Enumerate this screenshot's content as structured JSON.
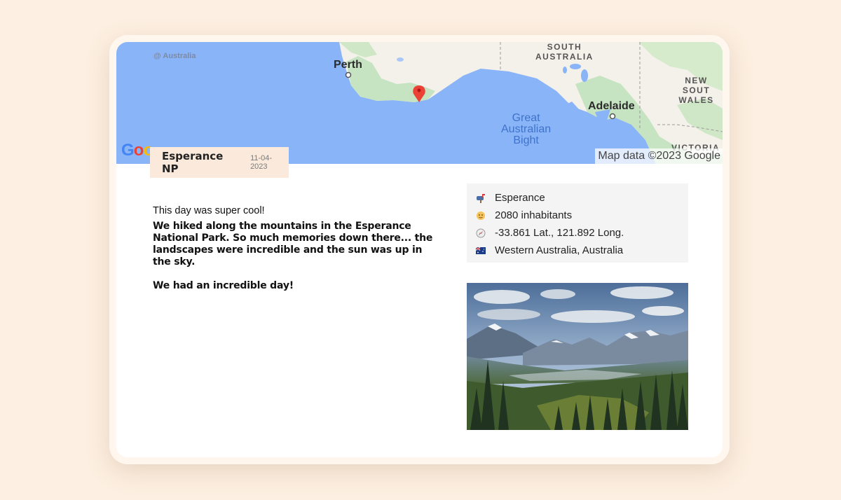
{
  "map": {
    "location_label": "@ Australia",
    "labels": {
      "south_australia": "SOUTH\nAUSTRALIA",
      "new_south_wales": "NEW SOUT\nWALES",
      "victoria": "VICTORIA",
      "perth": "Perth",
      "adelaide": "Adelaide",
      "bight": "Great\nAustralian\nBight"
    },
    "attribution": "Map data ©2023 Google",
    "logo": "Google"
  },
  "entry": {
    "title": "Esperance NP",
    "date": "11-04-2023",
    "intro": "This day was super cool!",
    "paragraph1": "We hiked along the mountains in the Esperance National Park. So much memories down there... the landscapes were incredible and the sun was up in the sky.",
    "paragraph2": "We had an incredible day!"
  },
  "info": {
    "place": "Esperance",
    "population": "2080 inhabitants",
    "coordinates": "-33.861 Lat., 121.892 Long.",
    "region": "Western Australia, Australia",
    "icons": [
      "mailbox-icon",
      "person-icon",
      "compass-icon",
      "australia-flag-icon"
    ]
  },
  "colors": {
    "background": "#fdefe1",
    "tab": "#fbeadb",
    "ocean": "#8ab4f8",
    "land": "#f4f1ea",
    "marker": "#ea4335"
  }
}
